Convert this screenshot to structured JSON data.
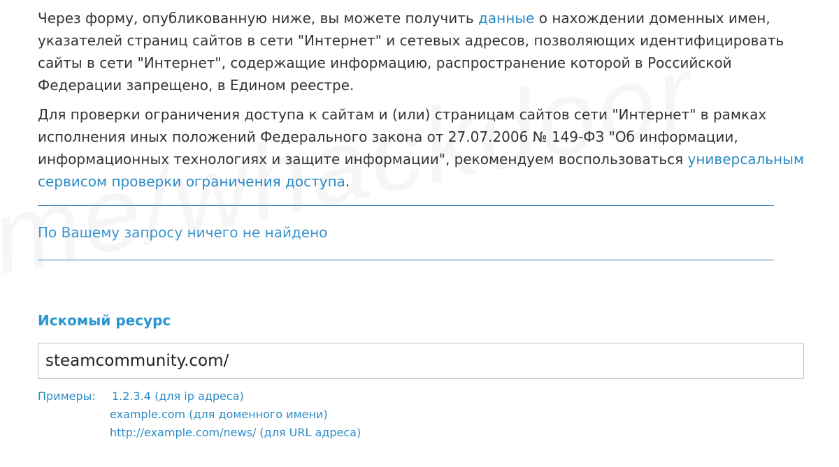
{
  "intro": {
    "before_link": "Через форму, опубликованную ниже, вы можете получить ",
    "link_text": "данные",
    "after_link": " о нахождении доменных имен, указателей страниц сайтов в сети \"Интернет\" и сетевых адресов, позволяющих идентифицировать сайты в сети \"Интернет\", содержащие информацию, распространение которой в Российской Федерации запрещено, в Едином реестре."
  },
  "check": {
    "text": "Для проверки ограничения доступа к сайтам и (или) страницам сайтов сети \"Интернет\" в рамках исполнения иных положений Федерального закона от 27.07.2006 № 149-ФЗ \"Об информации, информационных технологиях и защите информации\", рекомендуем воспользоваться ",
    "link_text": "универсальным сервисом проверки ограничения доступа",
    "after_link": "."
  },
  "result": {
    "message": "По Вашему запросу ничего не найдено"
  },
  "search": {
    "title": "Искомый ресурс",
    "value": "steamcommunity.com/",
    "examples_label": "Примеры:",
    "examples": [
      "1.2.3.4 (для ip адреса)",
      "example.com (для доменного имени)",
      "http://example.com/news/ (для URL адреса)"
    ]
  },
  "watermark": "me/whackdoor",
  "colors": {
    "link": "#2a8bc6",
    "text": "#333333",
    "divider": "#3a80b0"
  }
}
